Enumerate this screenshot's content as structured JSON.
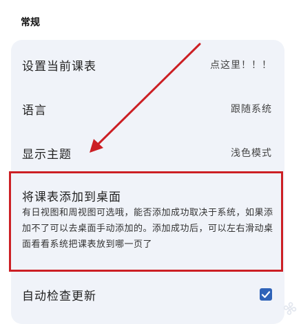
{
  "section": {
    "title": "常规"
  },
  "settings": {
    "current_timetable": {
      "label": "设置当前课表",
      "value": "点这里！！！"
    },
    "language": {
      "label": "语言",
      "value": "跟随系统"
    },
    "theme": {
      "label": "显示主题",
      "value": "浅色模式"
    },
    "add_widget": {
      "label": "将课表添加到桌面",
      "description": "有日视图和周视图可选哦，能否添加成功取决于系统，如果添加不了可以去桌面手动添加的。添加成功后，可以左右滑动桌面看看系统把课表放到哪一页了"
    },
    "auto_update": {
      "label": "自动检查更新",
      "checked": true
    }
  },
  "colors": {
    "accent": "#2f63b8",
    "highlight": "#cc1f24",
    "card_bg": "#f0f3f9"
  }
}
